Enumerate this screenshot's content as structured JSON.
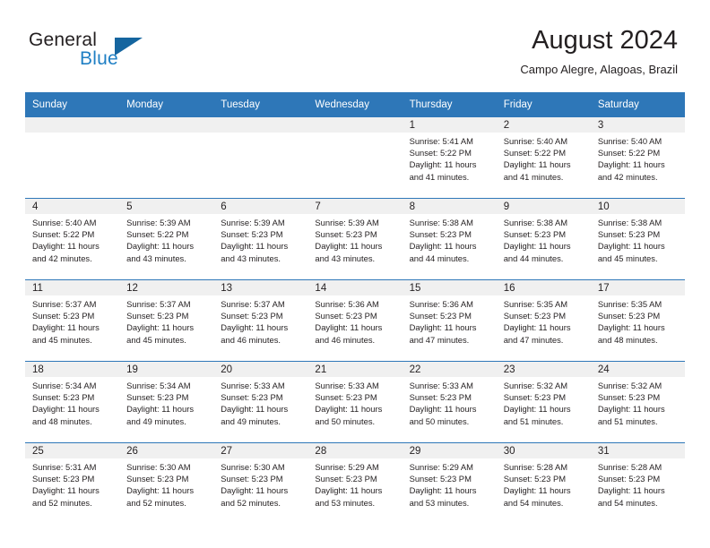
{
  "brand": {
    "name_part1": "General",
    "name_part2": "Blue",
    "triangle_color": "#15659f",
    "blue_text_color": "#1f7fc4"
  },
  "header": {
    "month_title": "August 2024",
    "location": "Campo Alegre, Alagoas, Brazil",
    "header_bg_color": "#2e77b8",
    "daynum_band_color": "#f0f0f0"
  },
  "weekday_headers": [
    "Sunday",
    "Monday",
    "Tuesday",
    "Wednesday",
    "Thursday",
    "Friday",
    "Saturday"
  ],
  "labels": {
    "sunrise_prefix": "Sunrise:",
    "sunset_prefix": "Sunset:",
    "daylight_prefix": "Daylight:"
  },
  "weeks": [
    [
      {
        "day": "",
        "empty": true,
        "line1": "",
        "line2": "",
        "line3": "",
        "line4": ""
      },
      {
        "day": "",
        "empty": true,
        "line1": "",
        "line2": "",
        "line3": "",
        "line4": ""
      },
      {
        "day": "",
        "empty": true,
        "line1": "",
        "line2": "",
        "line3": "",
        "line4": ""
      },
      {
        "day": "",
        "empty": true,
        "line1": "",
        "line2": "",
        "line3": "",
        "line4": ""
      },
      {
        "day": "1",
        "empty": false,
        "line1": "Sunrise: 5:41 AM",
        "line2": "Sunset: 5:22 PM",
        "line3": "Daylight: 11 hours",
        "line4": "and 41 minutes."
      },
      {
        "day": "2",
        "empty": false,
        "line1": "Sunrise: 5:40 AM",
        "line2": "Sunset: 5:22 PM",
        "line3": "Daylight: 11 hours",
        "line4": "and 41 minutes."
      },
      {
        "day": "3",
        "empty": false,
        "line1": "Sunrise: 5:40 AM",
        "line2": "Sunset: 5:22 PM",
        "line3": "Daylight: 11 hours",
        "line4": "and 42 minutes."
      }
    ],
    [
      {
        "day": "4",
        "empty": false,
        "line1": "Sunrise: 5:40 AM",
        "line2": "Sunset: 5:22 PM",
        "line3": "Daylight: 11 hours",
        "line4": "and 42 minutes."
      },
      {
        "day": "5",
        "empty": false,
        "line1": "Sunrise: 5:39 AM",
        "line2": "Sunset: 5:22 PM",
        "line3": "Daylight: 11 hours",
        "line4": "and 43 minutes."
      },
      {
        "day": "6",
        "empty": false,
        "line1": "Sunrise: 5:39 AM",
        "line2": "Sunset: 5:23 PM",
        "line3": "Daylight: 11 hours",
        "line4": "and 43 minutes."
      },
      {
        "day": "7",
        "empty": false,
        "line1": "Sunrise: 5:39 AM",
        "line2": "Sunset: 5:23 PM",
        "line3": "Daylight: 11 hours",
        "line4": "and 43 minutes."
      },
      {
        "day": "8",
        "empty": false,
        "line1": "Sunrise: 5:38 AM",
        "line2": "Sunset: 5:23 PM",
        "line3": "Daylight: 11 hours",
        "line4": "and 44 minutes."
      },
      {
        "day": "9",
        "empty": false,
        "line1": "Sunrise: 5:38 AM",
        "line2": "Sunset: 5:23 PM",
        "line3": "Daylight: 11 hours",
        "line4": "and 44 minutes."
      },
      {
        "day": "10",
        "empty": false,
        "line1": "Sunrise: 5:38 AM",
        "line2": "Sunset: 5:23 PM",
        "line3": "Daylight: 11 hours",
        "line4": "and 45 minutes."
      }
    ],
    [
      {
        "day": "11",
        "empty": false,
        "line1": "Sunrise: 5:37 AM",
        "line2": "Sunset: 5:23 PM",
        "line3": "Daylight: 11 hours",
        "line4": "and 45 minutes."
      },
      {
        "day": "12",
        "empty": false,
        "line1": "Sunrise: 5:37 AM",
        "line2": "Sunset: 5:23 PM",
        "line3": "Daylight: 11 hours",
        "line4": "and 45 minutes."
      },
      {
        "day": "13",
        "empty": false,
        "line1": "Sunrise: 5:37 AM",
        "line2": "Sunset: 5:23 PM",
        "line3": "Daylight: 11 hours",
        "line4": "and 46 minutes."
      },
      {
        "day": "14",
        "empty": false,
        "line1": "Sunrise: 5:36 AM",
        "line2": "Sunset: 5:23 PM",
        "line3": "Daylight: 11 hours",
        "line4": "and 46 minutes."
      },
      {
        "day": "15",
        "empty": false,
        "line1": "Sunrise: 5:36 AM",
        "line2": "Sunset: 5:23 PM",
        "line3": "Daylight: 11 hours",
        "line4": "and 47 minutes."
      },
      {
        "day": "16",
        "empty": false,
        "line1": "Sunrise: 5:35 AM",
        "line2": "Sunset: 5:23 PM",
        "line3": "Daylight: 11 hours",
        "line4": "and 47 minutes."
      },
      {
        "day": "17",
        "empty": false,
        "line1": "Sunrise: 5:35 AM",
        "line2": "Sunset: 5:23 PM",
        "line3": "Daylight: 11 hours",
        "line4": "and 48 minutes."
      }
    ],
    [
      {
        "day": "18",
        "empty": false,
        "line1": "Sunrise: 5:34 AM",
        "line2": "Sunset: 5:23 PM",
        "line3": "Daylight: 11 hours",
        "line4": "and 48 minutes."
      },
      {
        "day": "19",
        "empty": false,
        "line1": "Sunrise: 5:34 AM",
        "line2": "Sunset: 5:23 PM",
        "line3": "Daylight: 11 hours",
        "line4": "and 49 minutes."
      },
      {
        "day": "20",
        "empty": false,
        "line1": "Sunrise: 5:33 AM",
        "line2": "Sunset: 5:23 PM",
        "line3": "Daylight: 11 hours",
        "line4": "and 49 minutes."
      },
      {
        "day": "21",
        "empty": false,
        "line1": "Sunrise: 5:33 AM",
        "line2": "Sunset: 5:23 PM",
        "line3": "Daylight: 11 hours",
        "line4": "and 50 minutes."
      },
      {
        "day": "22",
        "empty": false,
        "line1": "Sunrise: 5:33 AM",
        "line2": "Sunset: 5:23 PM",
        "line3": "Daylight: 11 hours",
        "line4": "and 50 minutes."
      },
      {
        "day": "23",
        "empty": false,
        "line1": "Sunrise: 5:32 AM",
        "line2": "Sunset: 5:23 PM",
        "line3": "Daylight: 11 hours",
        "line4": "and 51 minutes."
      },
      {
        "day": "24",
        "empty": false,
        "line1": "Sunrise: 5:32 AM",
        "line2": "Sunset: 5:23 PM",
        "line3": "Daylight: 11 hours",
        "line4": "and 51 minutes."
      }
    ],
    [
      {
        "day": "25",
        "empty": false,
        "line1": "Sunrise: 5:31 AM",
        "line2": "Sunset: 5:23 PM",
        "line3": "Daylight: 11 hours",
        "line4": "and 52 minutes."
      },
      {
        "day": "26",
        "empty": false,
        "line1": "Sunrise: 5:30 AM",
        "line2": "Sunset: 5:23 PM",
        "line3": "Daylight: 11 hours",
        "line4": "and 52 minutes."
      },
      {
        "day": "27",
        "empty": false,
        "line1": "Sunrise: 5:30 AM",
        "line2": "Sunset: 5:23 PM",
        "line3": "Daylight: 11 hours",
        "line4": "and 52 minutes."
      },
      {
        "day": "28",
        "empty": false,
        "line1": "Sunrise: 5:29 AM",
        "line2": "Sunset: 5:23 PM",
        "line3": "Daylight: 11 hours",
        "line4": "and 53 minutes."
      },
      {
        "day": "29",
        "empty": false,
        "line1": "Sunrise: 5:29 AM",
        "line2": "Sunset: 5:23 PM",
        "line3": "Daylight: 11 hours",
        "line4": "and 53 minutes."
      },
      {
        "day": "30",
        "empty": false,
        "line1": "Sunrise: 5:28 AM",
        "line2": "Sunset: 5:23 PM",
        "line3": "Daylight: 11 hours",
        "line4": "and 54 minutes."
      },
      {
        "day": "31",
        "empty": false,
        "line1": "Sunrise: 5:28 AM",
        "line2": "Sunset: 5:23 PM",
        "line3": "Daylight: 11 hours",
        "line4": "and 54 minutes."
      }
    ]
  ]
}
